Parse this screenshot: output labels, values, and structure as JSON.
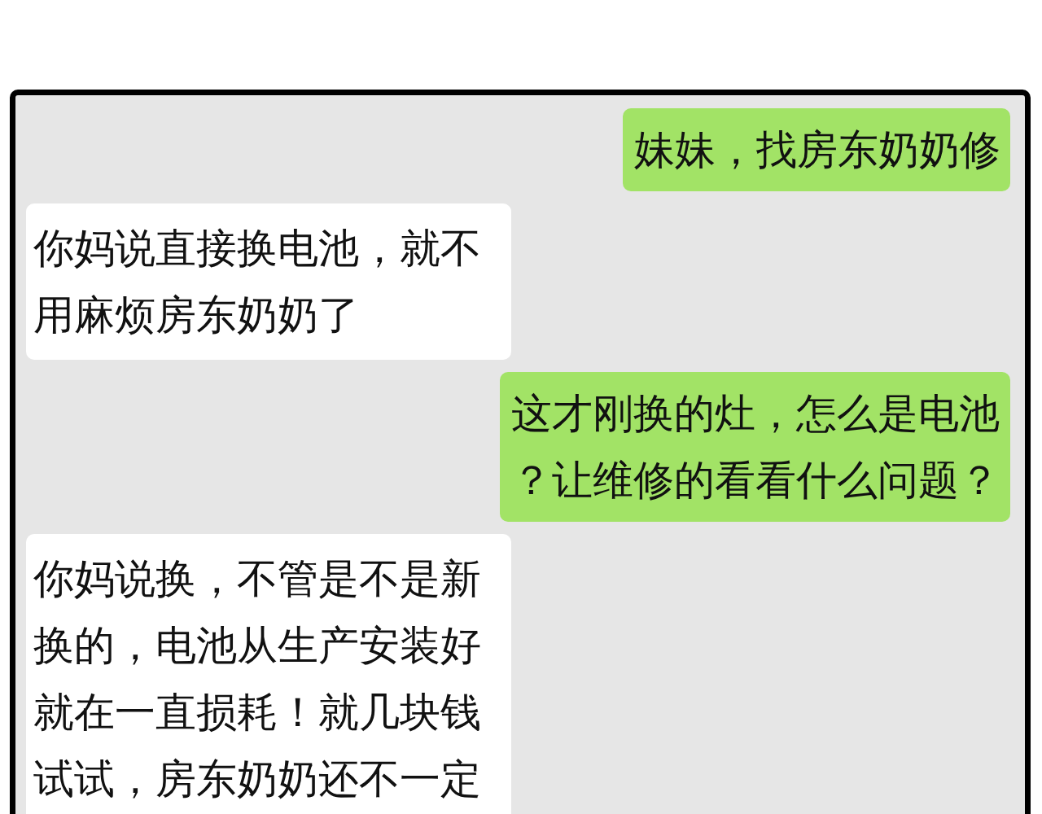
{
  "messages": [
    {
      "kind": "sent",
      "text": "妹妹，找房东奶奶修"
    },
    {
      "kind": "received",
      "text": "你妈说直接换电池，就不用麻烦房东奶奶了"
    },
    {
      "kind": "sent",
      "text": "这才刚换的灶，怎么是电池？让维修的看看什么问题？"
    },
    {
      "kind": "received",
      "text": "你妈说换，不管是不是新换的，电池从生产安装好就在一直损耗！就几块钱试试，房东奶奶还不一定"
    }
  ]
}
